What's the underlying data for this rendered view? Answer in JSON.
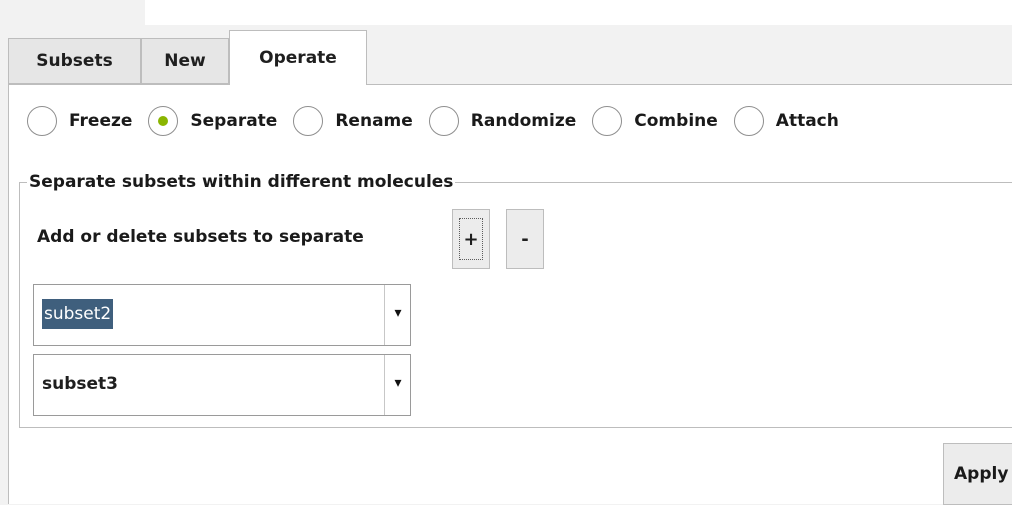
{
  "tabs": [
    "Subsets",
    "New",
    "Operate"
  ],
  "radios": [
    {
      "label": "Freeze",
      "checked": false
    },
    {
      "label": "Separate",
      "checked": true
    },
    {
      "label": "Rename",
      "checked": false
    },
    {
      "label": "Randomize",
      "checked": false
    },
    {
      "label": "Combine",
      "checked": false
    },
    {
      "label": "Attach",
      "checked": false
    }
  ],
  "group": {
    "title": "Separate subsets within different molecules",
    "instruction": "Add or delete subsets to separate",
    "buttons": {
      "add": "+",
      "remove": "-"
    },
    "combos": [
      {
        "value": "subset2",
        "selected": true
      },
      {
        "value": "subset3",
        "selected": false
      }
    ],
    "dropdown_symbol": "▾"
  },
  "actions": {
    "apply": "Apply"
  }
}
